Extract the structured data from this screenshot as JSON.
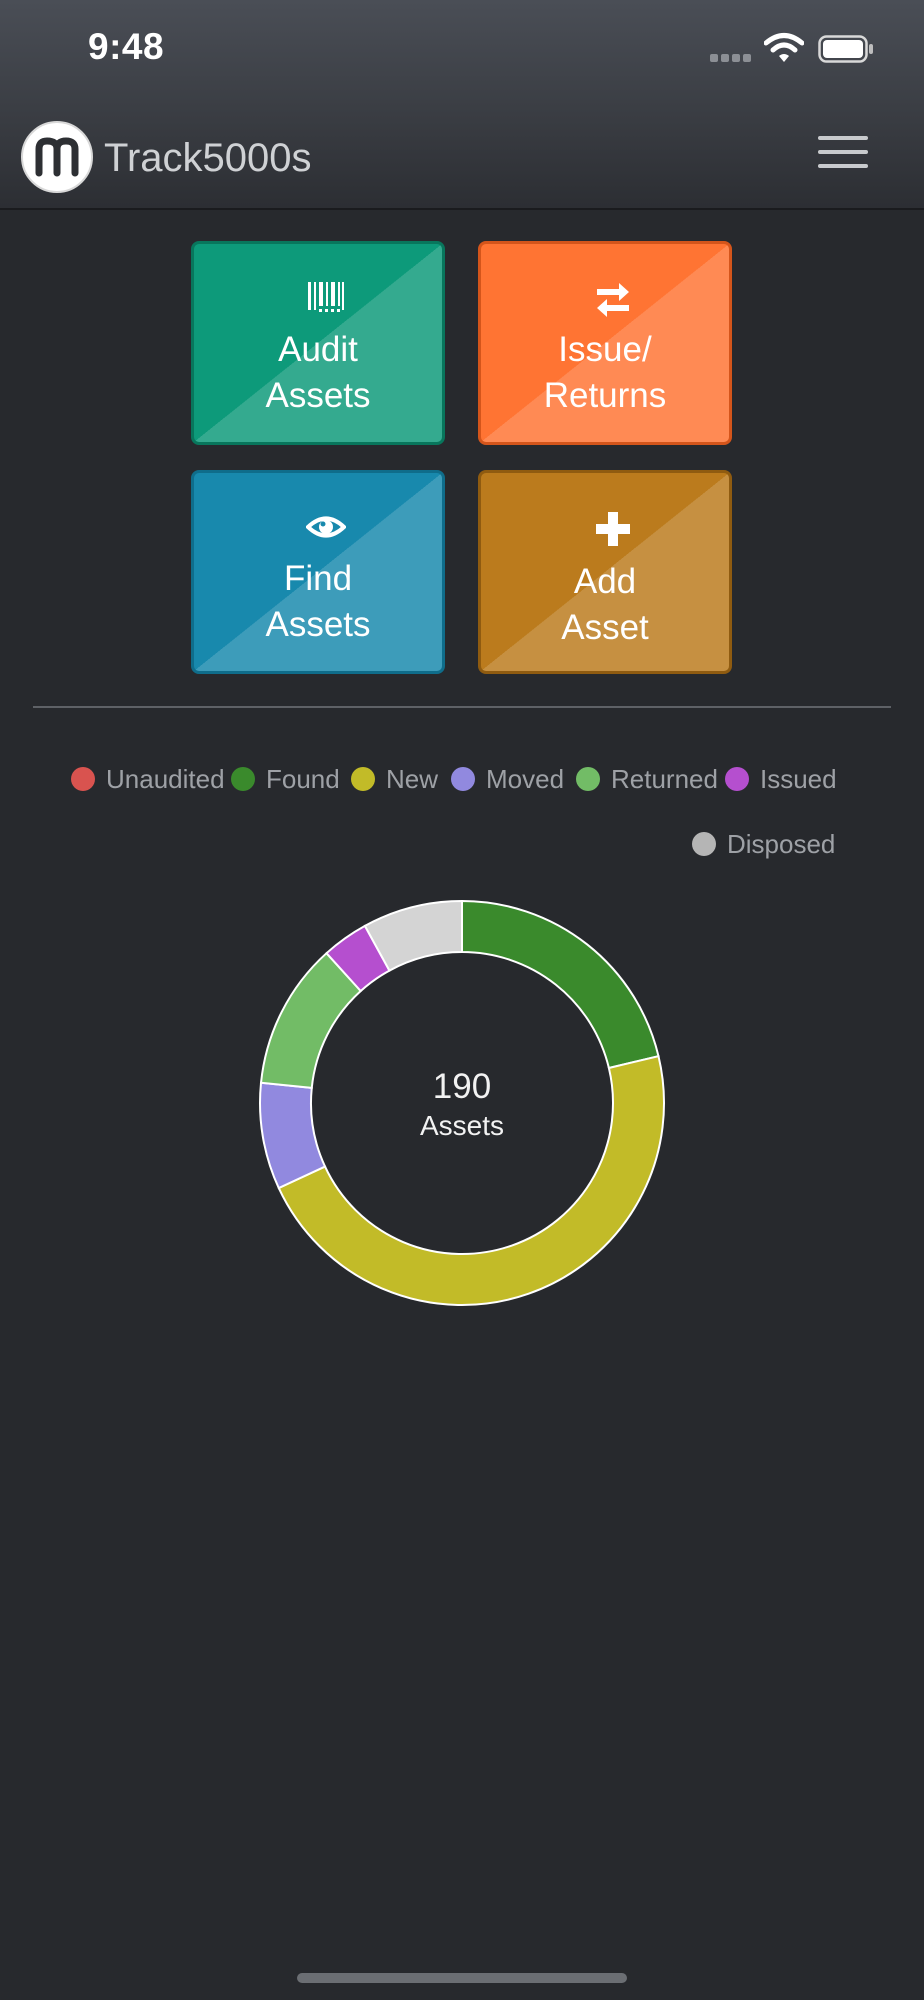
{
  "status_bar": {
    "time": "9:48"
  },
  "app_bar": {
    "title": "Track5000s",
    "logo_icon": "m-logo-icon",
    "menu_icon": "hamburger-menu-icon"
  },
  "actions": [
    {
      "icon": "barcode-icon",
      "line1": "Audit",
      "line2": "Assets",
      "color": "#0d9a7a"
    },
    {
      "icon": "swap-arrows-icon",
      "line1": "Issue/",
      "line2": "Returns",
      "color": "#ff7433"
    },
    {
      "icon": "eye-icon",
      "line1": "Find",
      "line2": "Assets",
      "color": "#1889ad"
    },
    {
      "icon": "plus-icon",
      "line1": "Add",
      "line2": "Asset",
      "color": "#bb7b1d"
    }
  ],
  "legend": [
    {
      "label": "Unaudited",
      "color": "#d9534f"
    },
    {
      "label": "Found",
      "color": "#3a8a2c"
    },
    {
      "label": "New",
      "color": "#c2bb28"
    },
    {
      "label": "Moved",
      "color": "#9189df"
    },
    {
      "label": "Returned",
      "color": "#72bc66"
    },
    {
      "label": "Issued",
      "color": "#b54fcf"
    },
    {
      "label": "Disposed",
      "color": "#b5b5b5"
    }
  ],
  "summary": {
    "count": "190",
    "label": "Assets"
  },
  "chart_data": {
    "type": "pie",
    "categories": [
      "Unaudited",
      "Found",
      "New",
      "Moved",
      "Returned",
      "Issued",
      "Disposed"
    ],
    "values": [
      0,
      40,
      88,
      16,
      22,
      7,
      15
    ],
    "colors": [
      "#d9534f",
      "#3a8a2c",
      "#c2bb28",
      "#9189df",
      "#72bc66",
      "#b54fcf",
      "#d4d4d4"
    ],
    "legend": "top-right",
    "style": "donut"
  }
}
